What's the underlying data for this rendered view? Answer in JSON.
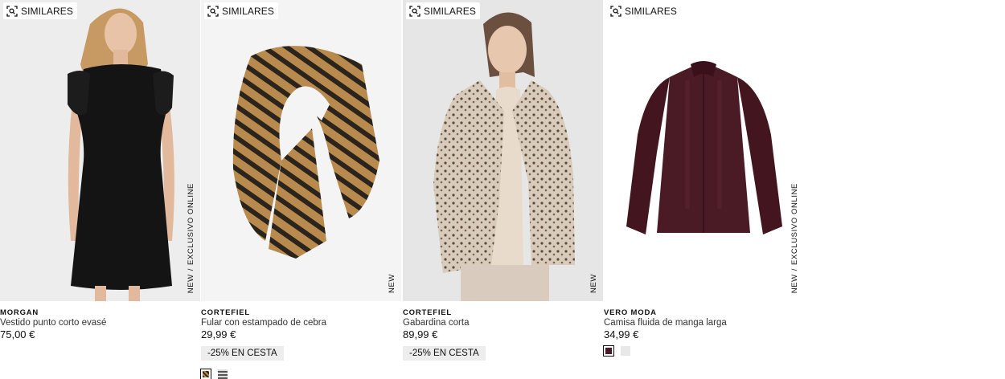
{
  "products": [
    {
      "similar_label": "SIMILARES",
      "tag_new": "NEW",
      "tag_exclusive": "EXCLUSIVO ONLINE",
      "brand": "MORGAN",
      "name": "Vestido punto corto evasé",
      "price": "75,00 €"
    },
    {
      "similar_label": "SIMILARES",
      "tag_new": "NEW",
      "brand": "CORTEFIEL",
      "name": "Fular con estampado de cebra",
      "price": "29,99 €",
      "promo": "-25% EN CESTA",
      "swatches": [
        "zebra-brown-pattern",
        "grey-stripe-pattern"
      ]
    },
    {
      "similar_label": "SIMILARES",
      "tag_new": "NEW",
      "brand": "CORTEFIEL",
      "name": "Gabardina corta",
      "price": "89,99 €",
      "promo": "-25% EN CESTA"
    },
    {
      "similar_label": "SIMILARES",
      "tag_new": "NEW",
      "tag_exclusive": "EXCLUSIVO ONLINE",
      "brand": "VERO MODA",
      "name": "Camisa fluida de manga larga",
      "price": "34,99 €",
      "swatches": [
        "#4a1a22",
        "#e8e8e8"
      ]
    }
  ],
  "icons": {
    "similar": "visual-search-icon"
  }
}
